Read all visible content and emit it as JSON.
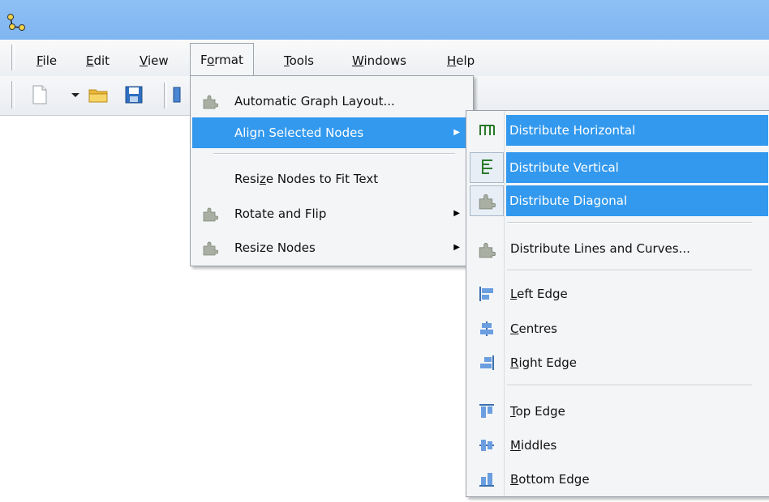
{
  "menubar": {
    "items": [
      {
        "pre": "",
        "u": "F",
        "post": "ile"
      },
      {
        "pre": "",
        "u": "E",
        "post": "dit"
      },
      {
        "pre": "",
        "u": "V",
        "post": "iew"
      },
      {
        "pre": "F",
        "u": "o",
        "post": "rmat"
      },
      {
        "pre": "",
        "u": "T",
        "post": "ools"
      },
      {
        "pre": "",
        "u": "W",
        "post": "indows"
      },
      {
        "pre": "",
        "u": "H",
        "post": "elp"
      }
    ]
  },
  "format_menu": {
    "items": [
      {
        "label": "Automatic Graph Layout...",
        "icon": "puzzle-icon"
      },
      {
        "label": "Align Selected Nodes",
        "highlighted": true,
        "submenu": true
      },
      {
        "pre": "Resi",
        "u": "z",
        "post": "e Nodes to Fit Text"
      },
      {
        "label": "Rotate and Flip",
        "icon": "puzzle-icon",
        "submenu": true
      },
      {
        "label": "Resize Nodes",
        "icon": "puzzle-icon",
        "submenu": true
      }
    ]
  },
  "align_submenu": {
    "items": [
      {
        "label": "Distribute Horizontal",
        "icon": "distribute-horizontal-icon",
        "highlighted": true
      },
      {
        "label": "Distribute Vertical",
        "icon": "distribute-vertical-icon",
        "highlighted": true
      },
      {
        "label": "Distribute Diagonal",
        "icon": "puzzle-icon",
        "highlighted": true
      },
      {
        "label": "Distribute Lines and Curves...",
        "icon": "puzzle-icon"
      },
      {
        "u": "L",
        "post": "eft Edge",
        "icon": "align-left-edge-icon"
      },
      {
        "u": "C",
        "post": "entres",
        "icon": "align-centres-icon"
      },
      {
        "u": "R",
        "post": "ight Edge",
        "icon": "align-right-edge-icon"
      },
      {
        "u": "T",
        "post": "op Edge",
        "icon": "align-top-edge-icon"
      },
      {
        "u": "M",
        "post": "iddles",
        "icon": "align-middles-icon"
      },
      {
        "u": "B",
        "post": "ottom Edge",
        "icon": "align-bottom-edge-icon"
      }
    ]
  },
  "colors": {
    "highlight": "#3399ee",
    "titlebar": "#8ec0f5"
  }
}
